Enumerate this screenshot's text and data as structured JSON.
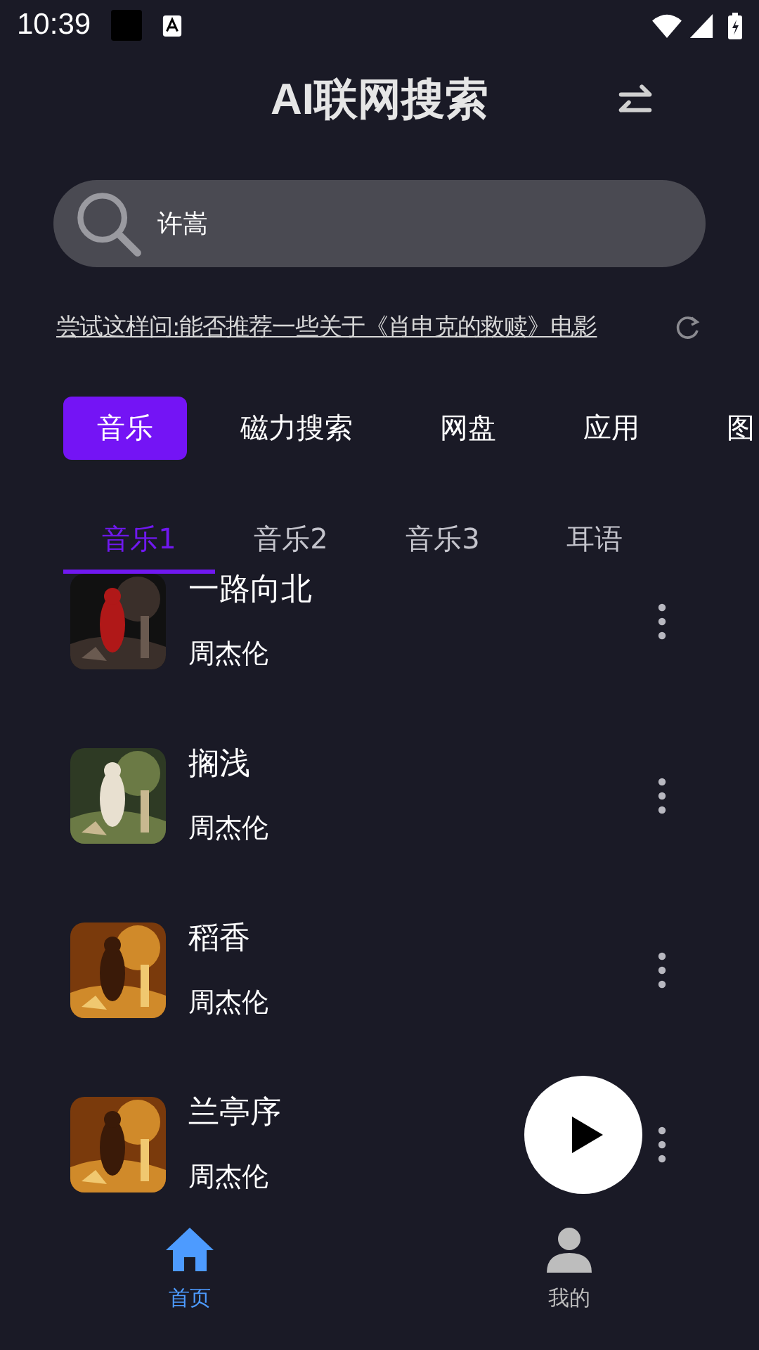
{
  "status_bar": {
    "time": "10:39"
  },
  "header": {
    "title": "AI联网搜索"
  },
  "search": {
    "value": "许嵩"
  },
  "suggestion": {
    "label": "尝试这样问:",
    "query": "能否推荐一些关于《肖申克的救赎》电影"
  },
  "categories": [
    {
      "label": "音乐",
      "selected": true
    },
    {
      "label": "磁力搜索",
      "selected": false
    },
    {
      "label": "网盘",
      "selected": false
    },
    {
      "label": "应用",
      "selected": false
    },
    {
      "label": "图",
      "selected": false
    }
  ],
  "sub_tabs": [
    {
      "label": "音乐1",
      "selected": true
    },
    {
      "label": "音乐2",
      "selected": false
    },
    {
      "label": "音乐3",
      "selected": false
    },
    {
      "label": "耳语",
      "selected": false
    }
  ],
  "songs": [
    {
      "title": "一路向北",
      "artist": "周杰伦"
    },
    {
      "title": "搁浅",
      "artist": "周杰伦"
    },
    {
      "title": "稻香",
      "artist": "周杰伦"
    },
    {
      "title": "兰亭序",
      "artist": "周杰伦"
    }
  ],
  "bottom_nav": [
    {
      "label": "首页",
      "selected": true
    },
    {
      "label": "我的",
      "selected": false
    }
  ]
}
